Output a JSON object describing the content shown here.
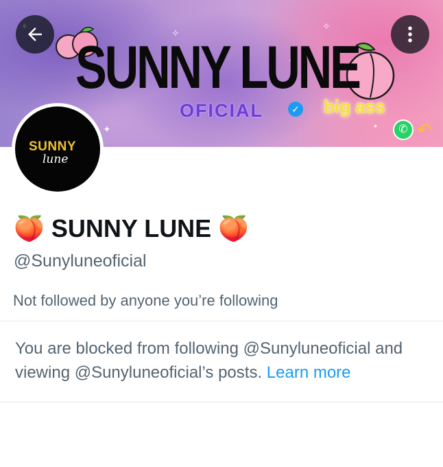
{
  "banner": {
    "title": "SUNNY LUNE",
    "oficial": "OFICIAL",
    "tagline": "big ass"
  },
  "header": {
    "back_icon": "arrow-left-icon",
    "more_icon": "more-vertical-icon"
  },
  "avatar": {
    "line1": "SUNNY",
    "line2": "lune"
  },
  "profile": {
    "name_emoji_left": "🍑",
    "name": "SUNNY LUNE",
    "name_emoji_right": "🍑",
    "handle": "@Sunyluneoficial",
    "followed_by": "Not followed by anyone you’re following"
  },
  "blocked": {
    "message": "You are blocked from following @Sunyluneoficial and viewing @Sunyluneoficial’s posts.",
    "link": "Learn more"
  },
  "colors": {
    "link": "#1d9bf0",
    "secondary_text": "#536471",
    "primary_text": "#0f1419"
  }
}
